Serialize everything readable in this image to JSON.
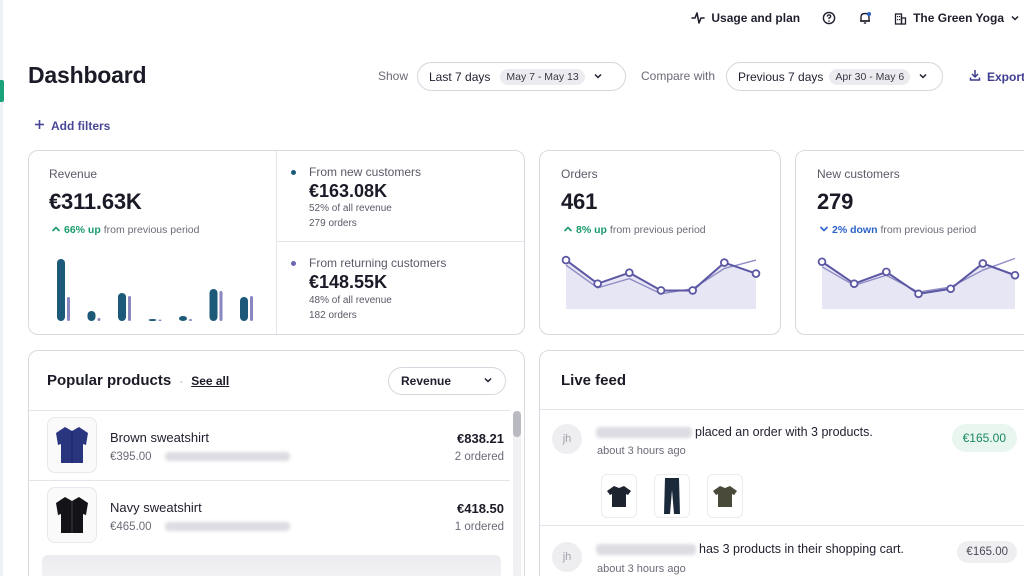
{
  "topbar": {
    "usage_label": "Usage and plan",
    "store_name": "The Green Yoga"
  },
  "header": {
    "title": "Dashboard",
    "show_label": "Show",
    "period_value": "Last 7 days",
    "period_dates": "May 7 - May 13",
    "compare_label": "Compare with",
    "compare_value": "Previous 7 days",
    "compare_dates": "Apr 30 - May 6",
    "export_label": "Export"
  },
  "filters": {
    "add_label": "Add filters"
  },
  "revenue": {
    "label": "Revenue",
    "value": "€311.63K",
    "trend_pct": "66% up",
    "trend_text": "from previous period",
    "bars": [
      {
        "current": 62,
        "previous": 24
      },
      {
        "current": 10,
        "previous": 3
      },
      {
        "current": 28,
        "previous": 25
      },
      {
        "current": 2,
        "previous": 1
      },
      {
        "current": 5,
        "previous": 2
      },
      {
        "current": 32,
        "previous": 30
      },
      {
        "current": 24,
        "previous": 25
      }
    ],
    "new": {
      "label": "From new customers",
      "value": "€163.08K",
      "share": "52% of all revenue",
      "orders": "279 orders"
    },
    "returning": {
      "label": "From returning customers",
      "value": "€148.55K",
      "share": "48% of all revenue",
      "orders": "182 orders"
    }
  },
  "orders": {
    "label": "Orders",
    "value": "461",
    "trend_pct": "8% up",
    "trend_text": "from previous period",
    "current": [
      58,
      30,
      43,
      22,
      22,
      55,
      42
    ],
    "previous": [
      52,
      25,
      36,
      18,
      24,
      48,
      58
    ]
  },
  "new_customers": {
    "label": "New customers",
    "value": "279",
    "trend_pct": "2% down",
    "trend_text": "from previous period",
    "current": [
      56,
      30,
      44,
      18,
      24,
      54,
      40
    ],
    "previous": [
      50,
      28,
      40,
      20,
      26,
      46,
      60
    ]
  },
  "popular_products": {
    "title": "Popular products",
    "see_all": "See all",
    "sort_value": "Revenue",
    "items": [
      {
        "name": "Brown sweatshirt",
        "price": "€395.00",
        "revenue": "€838.21",
        "ordered": "2 ordered",
        "icon": "jacket-icon"
      },
      {
        "name": "Navy sweatshirt",
        "price": "€465.00",
        "revenue": "€418.50",
        "ordered": "1 ordered",
        "icon": "jacket-icon"
      }
    ]
  },
  "live_feed": {
    "title": "Live feed",
    "entries": [
      {
        "initials": "jh",
        "text": "placed an order with 3 products.",
        "time": "about 3 hours ago",
        "amount": "€165.00"
      },
      {
        "initials": "jh",
        "text": "has 3 products in their shopping cart.",
        "time": "about 3 hours ago",
        "amount": "€165.00"
      }
    ]
  },
  "colors": {
    "accent": "#4a4896",
    "bar_current": "#1d5a7a",
    "bar_previous": "#8a86c0",
    "line": "#5b57a3",
    "up": "#1a9b6c",
    "down": "#2b63c7"
  }
}
